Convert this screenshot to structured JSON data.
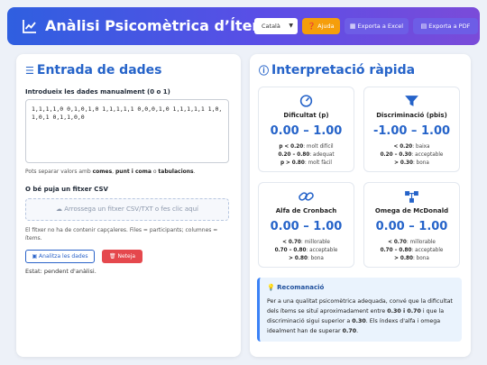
{
  "header": {
    "title": "Anàlisi Psicomètrica d’Ítems",
    "icon": "line-chart-icon",
    "language_selected": "Català",
    "help_label": "Ajuda",
    "export_excel_label": "Exporta a Excel",
    "export_pdf_label": "Exporta a PDF",
    "help_color": "#f59e0b",
    "accent_color": "#6d5de6"
  },
  "input_panel": {
    "title": "Entrada de dades",
    "manual_label": "Introdueix les dades manualment (0 o 1)",
    "manual_value": "1,1,1,1,0 0,1,0,1,0 1,1,1,1,1 0,0,0,1,0 1,1,1,1,1 1,0,1,0,1 0,1,1,0,0",
    "hint_prefix": "Pots separar valors amb ",
    "hint_commas": "comes",
    "hint_sep1": ", ",
    "hint_semicolon": "punt i coma",
    "hint_sep2": " o ",
    "hint_tabs": "tabulacions",
    "hint_suffix": ".",
    "csv_label": "O bé puja un fitxer CSV",
    "csv_dropzone": "Arrossega un fitxer CSV/TXT o fes clic aquí",
    "csv_note": "El fitxer no ha de contenir capçaleres. Files = participants; columnes = ítems.",
    "analyze_label": "Analitza les dades",
    "clear_label": "Neteja",
    "clear_color": "#e5484d",
    "status": "Estat: pendent d'anàlisi."
  },
  "interpretation_panel": {
    "title": "Interpretació ràpida",
    "cards": [
      {
        "title": "Dificultat (p)",
        "icon": "gauge-icon",
        "range": "0.00 – 1.00",
        "lines": [
          {
            "key": "p < 0.20",
            "text": ": molt difícil"
          },
          {
            "key": "0.20 – 0.80",
            "text": ": adequat"
          },
          {
            "key": "p > 0.80",
            "text": ": molt fàcil"
          }
        ]
      },
      {
        "title": "Discriminació (pbis)",
        "icon": "filter-icon",
        "range": "-1.00 – 1.00",
        "lines": [
          {
            "key": "< 0.20",
            "text": ": baixa"
          },
          {
            "key": "0.20 – 0.30",
            "text": ": acceptable"
          },
          {
            "key": "> 0.30",
            "text": ": bona"
          }
        ]
      },
      {
        "title": "Alfa de Cronbach",
        "icon": "link-icon",
        "range": "0.00 – 1.00",
        "lines": [
          {
            "key": "< 0.70",
            "text": ": millorable"
          },
          {
            "key": "0.70 – 0.80",
            "text": ": acceptable"
          },
          {
            "key": "> 0.80",
            "text": ": bona"
          }
        ]
      },
      {
        "title": "Omega de McDonald",
        "icon": "network-icon",
        "range": "0.00 – 1.00",
        "lines": [
          {
            "key": "< 0.70",
            "text": ": millorable"
          },
          {
            "key": "0.70 – 0.80",
            "text": ": acceptable"
          },
          {
            "key": "> 0.80",
            "text": ": bona"
          }
        ]
      }
    ],
    "recommendation": {
      "title": "Recomanació",
      "t1": "Per a una qualitat psicomètrica adequada, convé que la dificultat dels ítems se situï aproximadament entre ",
      "b1": "0.30 i 0.70",
      "t2": " i que la discriminació sigui superior a ",
      "b2": "0.30",
      "t3": ". Els índexs d'alfa i omega idealment han de superar ",
      "b3": "0.70",
      "t4": "."
    }
  }
}
